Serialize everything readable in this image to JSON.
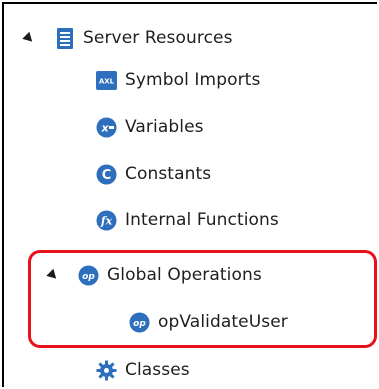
{
  "tree": {
    "root": {
      "label": "Server Resources",
      "icon": "document-list-icon",
      "expanded": true
    },
    "items": [
      {
        "label": "Symbol Imports",
        "icon": "axl-icon"
      },
      {
        "label": "Variables",
        "icon": "variables-icon"
      },
      {
        "label": "Constants",
        "icon": "constants-icon"
      },
      {
        "label": "Internal Functions",
        "icon": "function-icon"
      },
      {
        "label": "Global Operations",
        "icon": "operation-icon",
        "expanded": true,
        "children": [
          {
            "label": "opValidateUser",
            "icon": "operation-icon"
          }
        ]
      },
      {
        "label": "Classes",
        "icon": "gear-icon"
      }
    ]
  },
  "colors": {
    "highlight": "#e8101b",
    "icon_blue": "#2e6fbd",
    "text": "#1e1e1e"
  }
}
